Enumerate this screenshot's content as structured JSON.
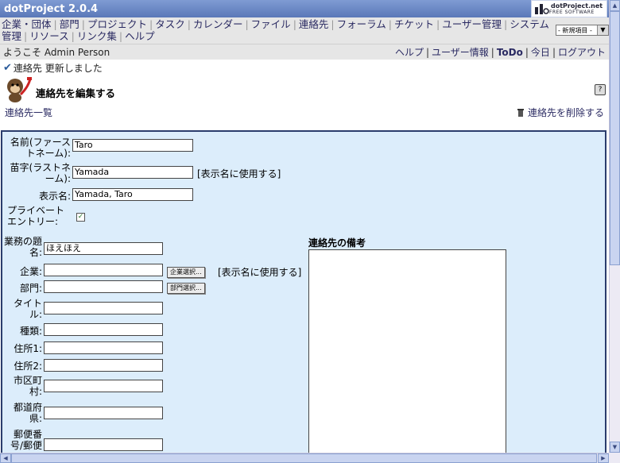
{
  "app": {
    "title": "dotProject 2.0.4",
    "brand_name": "dotProject.net",
    "brand_sub": "FREE SOFTWARE"
  },
  "nav": {
    "items": [
      "企業・団体",
      "部門",
      "プロジェクト",
      "タスク",
      "カレンダー",
      "ファイル",
      "連絡先",
      "フォーラム",
      "チケット",
      "ユーザー管理",
      "システム管理",
      "リソース",
      "リンク集",
      "ヘルプ"
    ],
    "new_item_select": "- 新規項目 -"
  },
  "welcome": {
    "text": "ようこそ Admin Person"
  },
  "top_links": {
    "help": "ヘルプ",
    "user_info": "ユーザー情報",
    "todo": "ToDo",
    "today": "今日",
    "logout": "ログアウト"
  },
  "status": {
    "message": "連絡先 更新しました"
  },
  "page": {
    "heading": "連絡先を編集する",
    "contacts_list_link": "連絡先一覧",
    "delete_link": "連絡先を削除する"
  },
  "form": {
    "first_name": {
      "label": "名前(ファーストネーム):",
      "value": "Taro"
    },
    "last_name": {
      "label": "苗字(ラストネーム):",
      "value": "Yamada"
    },
    "use_display_name": "[表示名に使用する]",
    "display_name": {
      "label": "表示名:",
      "value": "Yamada, Taro"
    },
    "private_entry": {
      "label": "プライベートエントリー:",
      "checked": true
    },
    "job_title": {
      "label": "業務の題名:",
      "value": "ほえほえ"
    },
    "company": {
      "label": "企業:",
      "value": "",
      "button": "企業選択...",
      "use_display_name": "[表示名に使用する]"
    },
    "department": {
      "label": "部門:",
      "value": "",
      "button": "部門選択..."
    },
    "title": {
      "label": "タイトル:",
      "value": ""
    },
    "type": {
      "label": "種類:",
      "value": ""
    },
    "address1": {
      "label": "住所1:",
      "value": ""
    },
    "address2": {
      "label": "住所2:",
      "value": ""
    },
    "city": {
      "label": "市区町村:",
      "value": ""
    },
    "state": {
      "label": "都道府県:",
      "value": ""
    },
    "zip": {
      "label": "郵便番号/郵便",
      "value": ""
    },
    "notes_title": "連絡先の備考",
    "notes_value": ""
  },
  "colors": {
    "accent": "#5a78b8",
    "form_bg": "#dcedfb",
    "form_border": "#2b3d6d",
    "link": "#2a2a62"
  }
}
